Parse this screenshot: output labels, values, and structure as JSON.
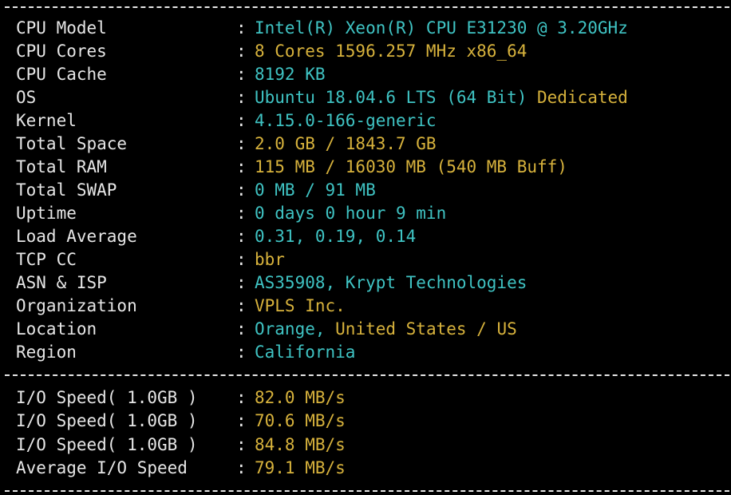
{
  "colors": {
    "background": "#000000",
    "label": "#e6e6e6",
    "cyan": "#3fc3c3",
    "yellow": "#d7b23c"
  },
  "separator": "-",
  "colon": ":",
  "info": [
    {
      "label": "CPU Model",
      "parts": [
        {
          "text": "Intel(R) Xeon(R) CPU E31230 @ 3.20GHz",
          "color": "cyan"
        }
      ]
    },
    {
      "label": "CPU Cores",
      "parts": [
        {
          "text": "8 Cores 1596.257 MHz x86_64",
          "color": "yellow"
        }
      ]
    },
    {
      "label": "CPU Cache",
      "parts": [
        {
          "text": "8192 KB",
          "color": "cyan"
        }
      ]
    },
    {
      "label": "OS",
      "parts": [
        {
          "text": "Ubuntu 18.04.6 LTS (64 Bit)",
          "color": "cyan"
        },
        {
          "text": " Dedicated",
          "color": "yellow"
        }
      ]
    },
    {
      "label": "Kernel",
      "parts": [
        {
          "text": "4.15.0-166-generic",
          "color": "cyan"
        }
      ]
    },
    {
      "label": "Total Space",
      "parts": [
        {
          "text": "2.0 GB / 1843.7 GB",
          "color": "yellow"
        }
      ]
    },
    {
      "label": "Total RAM",
      "parts": [
        {
          "text": "115 MB / 16030 MB (540 MB Buff)",
          "color": "yellow"
        }
      ]
    },
    {
      "label": "Total SWAP",
      "parts": [
        {
          "text": "0 MB / 91 MB",
          "color": "cyan"
        }
      ]
    },
    {
      "label": "Uptime",
      "parts": [
        {
          "text": "0 days 0 hour 9 min",
          "color": "cyan"
        }
      ]
    },
    {
      "label": "Load Average",
      "parts": [
        {
          "text": "0.31, 0.19, 0.14",
          "color": "cyan"
        }
      ]
    },
    {
      "label": "TCP CC",
      "parts": [
        {
          "text": "bbr",
          "color": "yellow"
        }
      ]
    },
    {
      "label": "ASN & ISP",
      "parts": [
        {
          "text": "AS35908, Krypt Technologies",
          "color": "cyan"
        }
      ]
    },
    {
      "label": "Organization",
      "parts": [
        {
          "text": "VPLS Inc.",
          "color": "yellow"
        }
      ]
    },
    {
      "label": "Location",
      "parts": [
        {
          "text": "Orange,",
          "color": "cyan"
        },
        {
          "text": " United States / US",
          "color": "yellow"
        }
      ]
    },
    {
      "label": "Region",
      "parts": [
        {
          "text": "California",
          "color": "cyan"
        }
      ]
    }
  ],
  "io": [
    {
      "label": "I/O Speed( 1.0GB )",
      "parts": [
        {
          "text": "82.0 MB/s",
          "color": "yellow"
        }
      ]
    },
    {
      "label": "I/O Speed( 1.0GB )",
      "parts": [
        {
          "text": "70.6 MB/s",
          "color": "yellow"
        }
      ]
    },
    {
      "label": "I/O Speed( 1.0GB )",
      "parts": [
        {
          "text": "84.8 MB/s",
          "color": "yellow"
        }
      ]
    },
    {
      "label": "Average I/O Speed",
      "parts": [
        {
          "text": "79.1 MB/s",
          "color": "yellow"
        }
      ]
    }
  ]
}
